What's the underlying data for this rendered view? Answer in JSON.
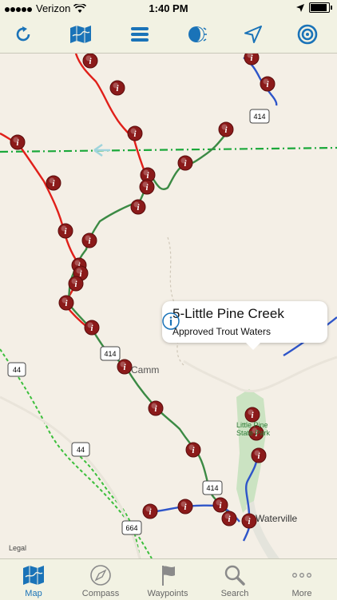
{
  "status_bar": {
    "carrier": "Verizon",
    "time": "1:40 PM"
  },
  "toolbar": {
    "buttons": [
      {
        "name": "refresh"
      },
      {
        "name": "map-layers"
      },
      {
        "name": "list"
      },
      {
        "name": "moon-phase"
      },
      {
        "name": "locate"
      },
      {
        "name": "target"
      }
    ],
    "accent": "#1a73b8"
  },
  "map": {
    "labels": {
      "cammal": "Camm",
      "waterville": "Waterville",
      "park": "Little Pine\nState Park",
      "legal": "Legal"
    },
    "route_shields": [
      "414",
      "414",
      "414",
      "44",
      "44",
      "664"
    ],
    "callout": {
      "title": "5-Little Pine Creek",
      "subtitle": "Approved Trout Waters"
    },
    "colors": {
      "red_stream": "#e0201a",
      "green_stream": "#3b8a44",
      "blue_stream": "#2e55c9",
      "boundary": "#1aa83a",
      "trail": "#3cbf3c",
      "marker": "#8b1a1a"
    }
  },
  "tabbar": {
    "tabs": [
      {
        "label": "Map",
        "active": true
      },
      {
        "label": "Compass",
        "active": false
      },
      {
        "label": "Waypoints",
        "active": false
      },
      {
        "label": "Search",
        "active": false
      },
      {
        "label": "More",
        "active": false
      }
    ]
  }
}
